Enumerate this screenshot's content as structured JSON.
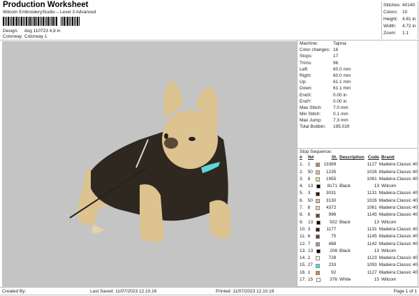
{
  "header": {
    "title": "Production Worksheet",
    "subtitle": "Wilcom EmbroideryStudio – Level 3 Advanced",
    "design_label": "Design:",
    "design_value": "dog 110723 4,8 in",
    "colorway_label": "Colorway:",
    "colorway_value": "Colorway 1"
  },
  "summary": [
    {
      "k": "Stitches:",
      "v": "40140"
    },
    {
      "k": "Colors:",
      "v": "10"
    },
    {
      "k": "Height:",
      "v": "4.81 in"
    },
    {
      "k": "Width:",
      "v": "4.72 in"
    },
    {
      "k": "Zoom:",
      "v": "1:1"
    }
  ],
  "machine_info": [
    {
      "k": "Machine:",
      "v": "Tajima"
    },
    {
      "k": "Color changes:",
      "v": "16"
    },
    {
      "k": "Stops:",
      "v": "17"
    },
    {
      "k": "Trims:",
      "v": "96"
    },
    {
      "k": "Left:",
      "v": "60.0 mm"
    },
    {
      "k": "Right:",
      "v": "60.0 mm"
    },
    {
      "k": "Up:",
      "v": "61.1 mm"
    },
    {
      "k": "Down:",
      "v": "61.1 mm"
    },
    {
      "k": "EndX:",
      "v": "0.00 in"
    },
    {
      "k": "EndY:",
      "v": "0.00 in"
    },
    {
      "k": "Max Stitch:",
      "v": "7.0 mm"
    },
    {
      "k": "Min Stitch:",
      "v": "0.1 mm"
    },
    {
      "k": "Max Jump:",
      "v": "7.3 mm"
    },
    {
      "k": "Total Bobbin:",
      "v": "195.01ft"
    }
  ],
  "stop_sequence": {
    "title": "Stop Sequence:",
    "columns": [
      "#",
      "N#",
      "St.",
      "Description",
      "Code",
      "Brand"
    ],
    "rows": [
      {
        "n": "1.",
        "num": "1",
        "color": "#c4895a",
        "st": "13369",
        "desc": "",
        "code": "1127",
        "brand": "Madeira Classic 40"
      },
      {
        "n": "2.",
        "num": "50",
        "color": "#eab98a",
        "st": "1235",
        "desc": "",
        "code": "1026",
        "brand": "Madeira Classic 40"
      },
      {
        "n": "3.",
        "num": "8",
        "color": "#f2daa8",
        "st": "1955",
        "desc": "",
        "code": "1061",
        "brand": "Madeira Classic 40"
      },
      {
        "n": "4.",
        "num": "13",
        "color": "#000000",
        "st": "8171",
        "desc": "Black",
        "code": "13",
        "brand": "Wilcom"
      },
      {
        "n": "5.",
        "num": "3",
        "color": "#2b1a10",
        "st": "3031",
        "desc": "",
        "code": "1131",
        "brand": "Madeira Classic 40"
      },
      {
        "n": "6.",
        "num": "50",
        "color": "#eab98a",
        "st": "3130",
        "desc": "",
        "code": "1026",
        "brand": "Madeira Classic 40"
      },
      {
        "n": "7.",
        "num": "8",
        "color": "#f2daa8",
        "st": "4372",
        "desc": "",
        "code": "1061",
        "brand": "Madeira Classic 40"
      },
      {
        "n": "8.",
        "num": "6",
        "color": "#6b4030",
        "st": "996",
        "desc": "",
        "code": "1145",
        "brand": "Madeira Classic 40"
      },
      {
        "n": "9.",
        "num": "13",
        "color": "#000000",
        "st": "502",
        "desc": "Black",
        "code": "13",
        "brand": "Wilcom"
      },
      {
        "n": "10.",
        "num": "3",
        "color": "#2b1a10",
        "st": "1177",
        "desc": "",
        "code": "1131",
        "brand": "Madeira Classic 40"
      },
      {
        "n": "11.",
        "num": "6",
        "color": "#6b4030",
        "st": "75",
        "desc": "",
        "code": "1145",
        "brand": "Madeira Classic 40"
      },
      {
        "n": "12.",
        "num": "7",
        "color": "#b8907e",
        "st": "488",
        "desc": "",
        "code": "1142",
        "brand": "Madeira Classic 40"
      },
      {
        "n": "13.",
        "num": "13",
        "color": "#000000",
        "st": "208",
        "desc": "Black",
        "code": "13",
        "brand": "Wilcom"
      },
      {
        "n": "14.",
        "num": "2",
        "color": "#f8f4e0",
        "st": "728",
        "desc": "",
        "code": "1123",
        "brand": "Madeira Classic 40"
      },
      {
        "n": "15.",
        "num": "27",
        "color": "#44e4ec",
        "st": "233",
        "desc": "",
        "code": "1093",
        "brand": "Madeira Classic 40"
      },
      {
        "n": "16.",
        "num": "1",
        "color": "#c4895a",
        "st": "92",
        "desc": "",
        "code": "1127",
        "brand": "Madeira Classic 40"
      },
      {
        "n": "17.",
        "num": "15",
        "color": "#ffffff",
        "st": "376",
        "desc": "White",
        "code": "15",
        "brand": "Wilcom"
      }
    ]
  },
  "footer": {
    "created_by": "Created By:",
    "last_saved": "Last Saved: 11/07/2023 12.10.16",
    "printed": "Printed: 11/07/2023 12.10.19",
    "page": "Page 1 of 1"
  }
}
